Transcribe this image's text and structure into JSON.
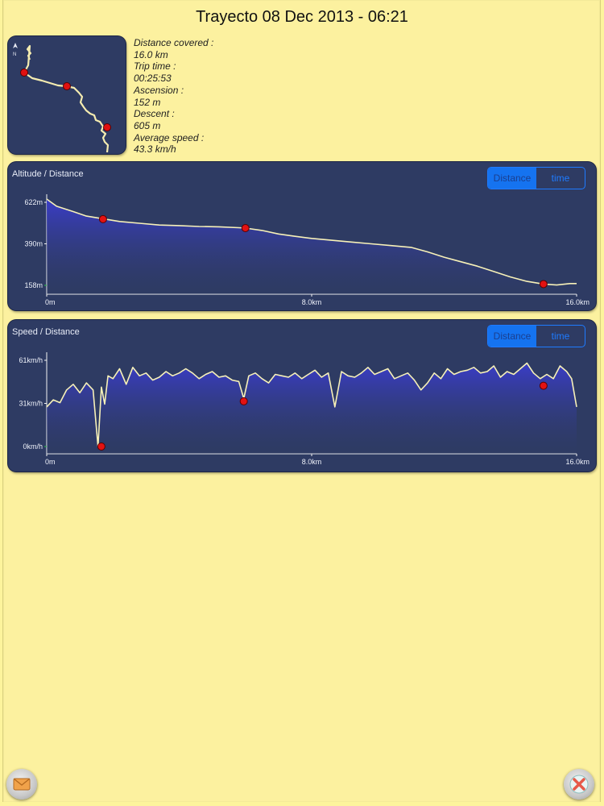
{
  "header": {
    "title": "Trayecto 08 Dec 2013 - 06:21"
  },
  "map": {
    "north_label": "N"
  },
  "stats": [
    {
      "label": "Distance covered :",
      "value": "16.0 km"
    },
    {
      "label": "Trip time :",
      "value": "00:25:53"
    },
    {
      "label": "Ascension :",
      "value": "152 m"
    },
    {
      "label": "Descent :",
      "value": "605 m"
    },
    {
      "label": "Average speed :",
      "value": "43.3 km/h"
    }
  ],
  "toggle": {
    "distance_label": "Distance",
    "time_label": "time"
  },
  "chart_data": [
    {
      "type": "area",
      "title": "Altitude / Distance",
      "xticks": [
        "0m",
        "8.0km",
        "16.0km"
      ],
      "yticks": [
        "622m",
        "390m",
        "158m"
      ],
      "xlim": [
        0,
        16
      ],
      "ylim": [
        158,
        622
      ],
      "series": [
        {
          "x": [
            0,
            0.3,
            0.8,
            1.2,
            1.7,
            2.2,
            2.8,
            3.4,
            4.0,
            4.6,
            5.2,
            5.8,
            6.0,
            6.5,
            7.0,
            7.5,
            8.0,
            8.6,
            9.2,
            9.8,
            10.4,
            11.0,
            11.5,
            12.0,
            12.5,
            13.0,
            13.5,
            14.0,
            14.5,
            15.0,
            15.4,
            15.8,
            16.0
          ],
          "y": [
            640,
            600,
            570,
            545,
            530,
            515,
            505,
            495,
            492,
            487,
            485,
            480,
            478,
            465,
            445,
            432,
            420,
            410,
            400,
            390,
            380,
            370,
            345,
            315,
            290,
            265,
            235,
            205,
            180,
            165,
            160,
            168,
            168
          ]
        }
      ],
      "markers": [
        {
          "x": 1.7,
          "y": 528
        },
        {
          "x": 6.0,
          "y": 478
        },
        {
          "x": 15.0,
          "y": 165
        }
      ],
      "grid": false
    },
    {
      "type": "area",
      "title": "Speed / Distance",
      "xticks": [
        "0m",
        "8.0km",
        "16.0km"
      ],
      "yticks": [
        "61km/h",
        "31km/h",
        "0km/h"
      ],
      "xlim": [
        0,
        16
      ],
      "ylim": [
        0,
        61
      ],
      "series": [
        {
          "x": [
            0,
            0.2,
            0.4,
            0.6,
            0.8,
            1.0,
            1.2,
            1.4,
            1.55,
            1.65,
            1.75,
            1.85,
            2.0,
            2.2,
            2.4,
            2.6,
            2.8,
            3.0,
            3.2,
            3.4,
            3.6,
            3.8,
            4.0,
            4.2,
            4.4,
            4.6,
            4.8,
            5.0,
            5.2,
            5.4,
            5.6,
            5.8,
            5.95,
            6.1,
            6.3,
            6.5,
            6.7,
            6.9,
            7.1,
            7.3,
            7.5,
            7.7,
            7.9,
            8.1,
            8.3,
            8.5,
            8.7,
            8.9,
            9.1,
            9.3,
            9.5,
            9.7,
            9.9,
            10.1,
            10.3,
            10.5,
            10.7,
            10.9,
            11.1,
            11.3,
            11.5,
            11.7,
            11.9,
            12.1,
            12.3,
            12.5,
            12.7,
            12.9,
            13.1,
            13.3,
            13.5,
            13.7,
            13.9,
            14.1,
            14.3,
            14.5,
            14.7,
            14.9,
            15.1,
            15.3,
            15.5,
            15.7,
            15.85,
            16.0
          ],
          "y": [
            28,
            33,
            31,
            40,
            44,
            38,
            45,
            40,
            0,
            42,
            30,
            50,
            48,
            55,
            44,
            56,
            50,
            52,
            47,
            49,
            53,
            50,
            52,
            55,
            52,
            48,
            51,
            53,
            49,
            50,
            47,
            46,
            34,
            50,
            52,
            48,
            45,
            51,
            50,
            49,
            52,
            48,
            51,
            54,
            49,
            52,
            28,
            53,
            50,
            49,
            52,
            56,
            51,
            53,
            55,
            48,
            50,
            52,
            47,
            40,
            45,
            52,
            48,
            55,
            51,
            53,
            54,
            56,
            52,
            53,
            57,
            49,
            53,
            51,
            55,
            59,
            52,
            48,
            51,
            48,
            57,
            53,
            48,
            28
          ]
        }
      ],
      "markers": [
        {
          "x": 1.65,
          "y": 0
        },
        {
          "x": 5.95,
          "y": 32
        },
        {
          "x": 15.0,
          "y": 43
        }
      ],
      "grid": false
    }
  ],
  "footer": {
    "mail_icon": "envelope-icon",
    "close_icon": "close-x-icon"
  }
}
